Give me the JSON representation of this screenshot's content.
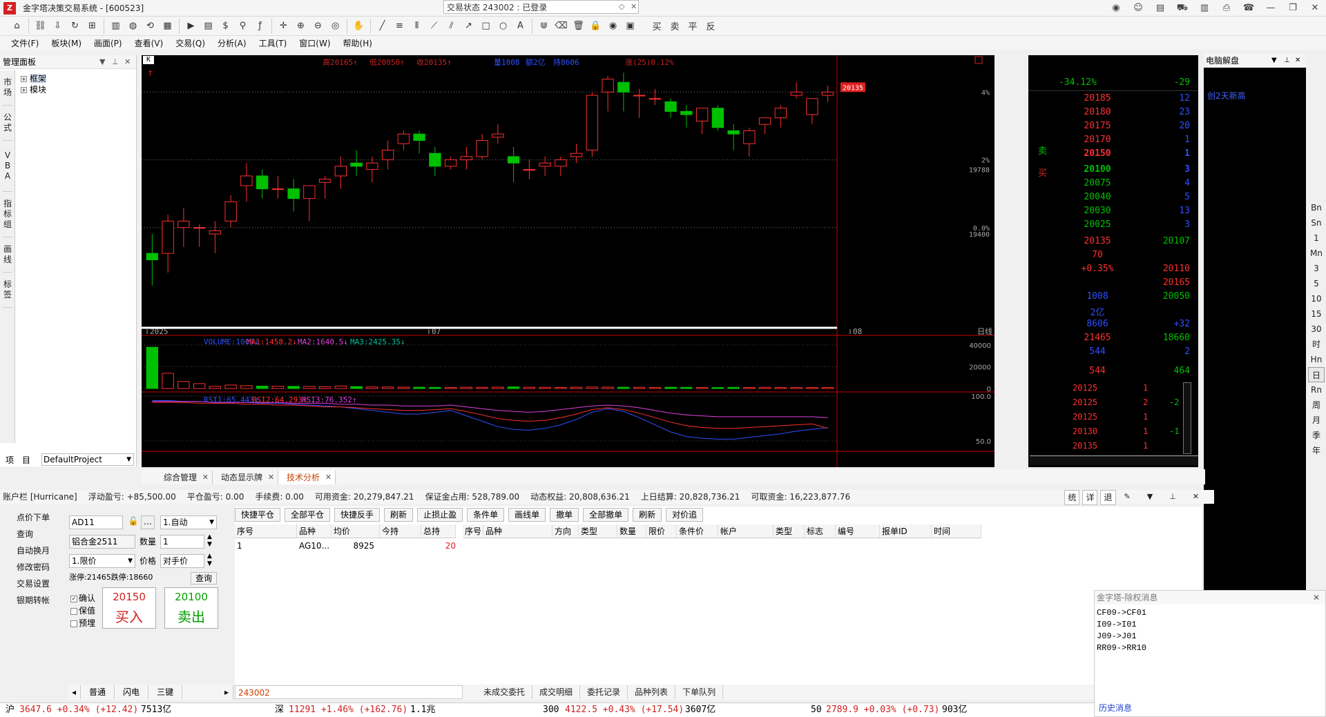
{
  "window": {
    "title": "金字塔决策交易系统 - [600523]",
    "trade_status": "交易状态 243002 : 已登录"
  },
  "title_icons": [
    "rss-icon",
    "user-icon",
    "document-icon",
    "cart-icon",
    "stats-icon",
    "print-icon",
    "support-icon",
    "minimize-icon",
    "restore-icon",
    "close-icon"
  ],
  "toolbar": {
    "trade_buttons": [
      "买",
      "卖",
      "平",
      "反"
    ]
  },
  "menu": [
    "文件(F)",
    "板块(M)",
    "画面(P)",
    "查看(V)",
    "交易(Q)",
    "分析(A)",
    "工具(T)",
    "窗口(W)",
    "帮助(H)"
  ],
  "left_panel": {
    "title": "管理面板",
    "tabs": [
      "市场",
      "公式",
      "VBA",
      "指标组",
      "画线",
      "标签"
    ],
    "tree": [
      {
        "label": "框架",
        "expanded": "+"
      },
      {
        "label": "模块",
        "expanded": "+"
      }
    ],
    "bottom_tabs": [
      "项",
      "目"
    ],
    "project": "DefaultProject"
  },
  "chart": {
    "badge": "K",
    "info_high": "高20165↑",
    "info_low": "低20050↑",
    "info_close": "收20135↑",
    "info_vol": "量1008",
    "info_amount": "额2亿",
    "info_oi": "持8606",
    "info_change": "涨(25)0.12%",
    "price_tag": "20135",
    "y_labels": [
      {
        "text": "4%"
      },
      {
        "text": "2%"
      },
      {
        "text": "19788"
      },
      {
        "text": "0.0%"
      },
      {
        "text": "19400"
      }
    ],
    "x_labels": [
      "2025",
      "07",
      "08"
    ],
    "period_label": "日线",
    "vol_indicator": {
      "v": "VOLUME:1008↓",
      "ma1": "MA1:1458.2↓",
      "ma2": "MA2:1640.5↓",
      "ma3": "MA3:2425.35↓"
    },
    "vol_axis": [
      "40000",
      "20000",
      "0"
    ],
    "rsi_indicator": {
      "r1": "RSI1:65.443↑",
      "r2": "RSI2:64.293↑",
      "r3": "RSI3:76.352↑"
    },
    "rsi_axis": [
      "100.0",
      "50.0"
    ]
  },
  "chart_data": {
    "type": "candlestick",
    "x_ticks": [
      "2025",
      "07",
      "08"
    ],
    "candles": [
      [
        19620,
        19680,
        19600,
        19520
      ],
      [
        19620,
        19740,
        19720,
        19560
      ],
      [
        19700,
        19760,
        19720,
        19640
      ],
      [
        19700,
        19710,
        19700,
        19640
      ],
      [
        19680,
        19720,
        19690,
        19620
      ],
      [
        19720,
        19800,
        19780,
        19700
      ],
      [
        19830,
        19900,
        19860,
        19780
      ],
      [
        19860,
        19880,
        19820,
        19790
      ],
      [
        19820,
        19860,
        19820,
        19790
      ],
      [
        19820,
        19850,
        19790,
        19750
      ],
      [
        19790,
        19820,
        19830,
        19720
      ],
      [
        19840,
        19860,
        19850,
        19790
      ],
      [
        19860,
        19920,
        19890,
        19820
      ],
      [
        19900,
        19940,
        19890,
        19860
      ],
      [
        19880,
        19920,
        19900,
        19840
      ],
      [
        19910,
        19970,
        19940,
        19880
      ],
      [
        19960,
        20000,
        19990,
        19940
      ],
      [
        19990,
        20000,
        19970,
        19930
      ],
      [
        19930,
        19950,
        19890,
        19860
      ],
      [
        19890,
        19920,
        19910,
        19880
      ],
      [
        19910,
        19950,
        19920,
        19880
      ],
      [
        19920,
        19990,
        19970,
        19910
      ],
      [
        19980,
        20020,
        19990,
        19960
      ],
      [
        19920,
        19950,
        19900,
        19840
      ],
      [
        19880,
        19910,
        19880,
        19850
      ],
      [
        19890,
        19920,
        19900,
        19860
      ],
      [
        19890,
        19920,
        19910,
        19860
      ],
      [
        19920,
        19960,
        19930,
        19900
      ],
      [
        19940,
        20120,
        20110,
        19920
      ],
      [
        20120,
        20170,
        20160,
        20060
      ],
      [
        20150,
        20180,
        20120,
        20060
      ],
      [
        20110,
        20130,
        20110,
        20040
      ],
      [
        20100,
        20130,
        20100,
        20080
      ],
      [
        20090,
        20100,
        20060,
        20040
      ],
      [
        20060,
        20080,
        20050,
        20010
      ],
      [
        20030,
        20070,
        20070,
        19990
      ],
      [
        20070,
        20080,
        20010,
        20000
      ],
      [
        20000,
        20020,
        19990,
        19940
      ],
      [
        19960,
        20010,
        20000,
        19920
      ],
      [
        20020,
        20040,
        20040,
        19990
      ],
      [
        20040,
        20080,
        20070,
        20010
      ],
      [
        20110,
        20150,
        20120,
        20100
      ],
      [
        20050,
        20100,
        20100,
        20020
      ],
      [
        20110,
        20140,
        20120,
        20090
      ]
    ],
    "volume": [
      38000,
      14000,
      6500,
      4500,
      2000,
      3200,
      2600,
      2200,
      2100,
      2000,
      1900,
      1700,
      2300,
      1800,
      1500,
      1400,
      1300,
      1200,
      1100,
      1000,
      1200,
      1100,
      1300,
      1500,
      1200,
      1100,
      1000,
      1200,
      1400,
      1300,
      1200,
      1100,
      1000,
      1200,
      1100,
      1000,
      900,
      1100,
      1000,
      1100,
      1000,
      1008,
      900,
      1000
    ],
    "rsi1": [
      95,
      95,
      94,
      94,
      93,
      93,
      93,
      92,
      92,
      91,
      90,
      89,
      88,
      86,
      84,
      82,
      80,
      80,
      82,
      84,
      78,
      72,
      66,
      63,
      62,
      64,
      68,
      74,
      82,
      86,
      83,
      76,
      68,
      60,
      55,
      53,
      52,
      52,
      54,
      56,
      58,
      61,
      63,
      65
    ],
    "rsi2": [
      93,
      93,
      93,
      92,
      92,
      92,
      91,
      91,
      90,
      90,
      89,
      88,
      88,
      87,
      86,
      85,
      84,
      84,
      85,
      86,
      83,
      79,
      75,
      73,
      72,
      73,
      76,
      80,
      85,
      87,
      85,
      81,
      76,
      71,
      67,
      65,
      64,
      64,
      65,
      66,
      67,
      68,
      69,
      64
    ],
    "rsi3": [
      94,
      94,
      94,
      94,
      93,
      93,
      93,
      93,
      93,
      92,
      92,
      92,
      91,
      91,
      90,
      90,
      89,
      89,
      89,
      90,
      88,
      86,
      84,
      83,
      82,
      83,
      85,
      87,
      89,
      90,
      89,
      87,
      84,
      81,
      79,
      78,
      77,
      77,
      77,
      77,
      77,
      77,
      77,
      76
    ],
    "ylim": [
      19400,
      20200
    ]
  },
  "orderbook": {
    "header_top": "-34.12%",
    "header_top_right": "-29",
    "sell_label": "卖",
    "buy_label": "买",
    "asks": [
      [
        "20185",
        "12"
      ],
      [
        "20180",
        "23"
      ],
      [
        "20175",
        "20"
      ],
      [
        "20170",
        "1"
      ],
      [
        "20150",
        "1"
      ]
    ],
    "bids": [
      [
        "20100",
        "3"
      ],
      [
        "20075",
        "4"
      ],
      [
        "20040",
        "5"
      ],
      [
        "20030",
        "13"
      ],
      [
        "20025",
        "3"
      ]
    ],
    "stats": [
      [
        "20135",
        "20107"
      ],
      [
        "70",
        ""
      ],
      [
        "+0.35%",
        "20110"
      ],
      [
        "",
        "20165"
      ],
      [
        "1008",
        "20050"
      ],
      [
        "2亿",
        ""
      ],
      [
        "8606",
        "+32"
      ],
      [
        "21465",
        "18660"
      ],
      [
        "544",
        "2"
      ]
    ],
    "bottom": [
      "544",
      "464"
    ],
    "ticks": [
      [
        "20125",
        "1",
        ""
      ],
      [
        "20125",
        "2",
        "-2"
      ],
      [
        "20125",
        "1",
        ""
      ],
      [
        "20130",
        "1",
        "-1"
      ],
      [
        "20135",
        "1",
        ""
      ]
    ]
  },
  "right_panel": {
    "title": "电脑解盘",
    "link": "创2天新高"
  },
  "period_bar": [
    "Bn",
    "Sn",
    "1",
    "Mn",
    "3",
    "5",
    "10",
    "15",
    "30",
    "时",
    "Hn",
    "日",
    "Rn",
    "周",
    "月",
    "季",
    "年"
  ],
  "tabs": [
    {
      "label": "综合管理"
    },
    {
      "label": "动态显示牌"
    },
    {
      "label": "技术分析"
    }
  ],
  "account": {
    "title": "账户栏 [Hurricane]",
    "float_pnl": "浮动盈亏: +85,500.00",
    "close_pnl": "平仓盈亏: 0.00",
    "fee": "手续费: 0.00",
    "available": "可用资金: 20,279,847.21",
    "margin": "保证金占用: 528,789.00",
    "equity": "动态权益: 20,808,636.21",
    "last_settle": "上日结算: 20,828,736.21",
    "withdraw": "可取资金: 16,223,877.76",
    "ctrls": [
      "统",
      "详",
      "退"
    ]
  },
  "trade_menu": [
    "点价下单",
    "查询",
    "自动换月",
    "修改密码",
    "交易设置",
    "银期转帐"
  ],
  "trade_form": {
    "code": "AD11",
    "mode": "1.自动",
    "name": "铝合金2511",
    "qty_label": "数量",
    "qty": "1",
    "order_type": "1.限价",
    "price_label": "价格",
    "price": "对手价",
    "limits": "涨停:21465跌停:18660",
    "query_btn": "查询",
    "confirm": "确认",
    "hedge": "保值",
    "preorder": "预埋",
    "buy_price": "20150",
    "buy_label": "买入",
    "sell_price": "20100",
    "sell_label": "卖出"
  },
  "order_buttons": [
    "快捷平仓",
    "全部平仓",
    "快捷反手",
    "刷新",
    "止损止盈",
    "条件单",
    "画线单",
    "撤单",
    "全部撤单",
    "刷新",
    "对价追"
  ],
  "pos_headers": [
    "序号",
    "品种",
    "均价",
    "今持",
    "总持"
  ],
  "pos_row": [
    "1",
    "AG10...",
    "8925",
    "",
    "20"
  ],
  "ord_headers": [
    "序号",
    "品种",
    "方向",
    "类型",
    "数量",
    "限价",
    "条件价",
    "帐户",
    "类型",
    "标志",
    "编号",
    "报单ID",
    "时间"
  ],
  "mini_tabs": [
    "普通",
    "闪电",
    "三键"
  ],
  "account_id": "243002",
  "bottom_tabs": [
    "未成交委托",
    "成交明细",
    "委托记录",
    "品种列表",
    "下单队列"
  ],
  "msg": {
    "title": "金字塔-除权消息",
    "lines": [
      "CF09->CF01",
      "I09->I01",
      "J09->J01",
      "RR09->RR10"
    ],
    "footer": "历史消息"
  },
  "ticker": {
    "sh": {
      "name": "沪",
      "val": "3647.6 +0.34% (+12.42)",
      "amt": "7513亿"
    },
    "sz": {
      "name": "深",
      "val": "11291 +1.46% (+162.76)",
      "amt": "1.1兆"
    },
    "i300": {
      "name": "300",
      "val": "4122.5 +0.43% (+17.54)",
      "amt": "3607亿"
    },
    "i50": {
      "name": "50",
      "val": "2789.9 +0.03% (+0.73)",
      "amt": "903亿"
    }
  }
}
